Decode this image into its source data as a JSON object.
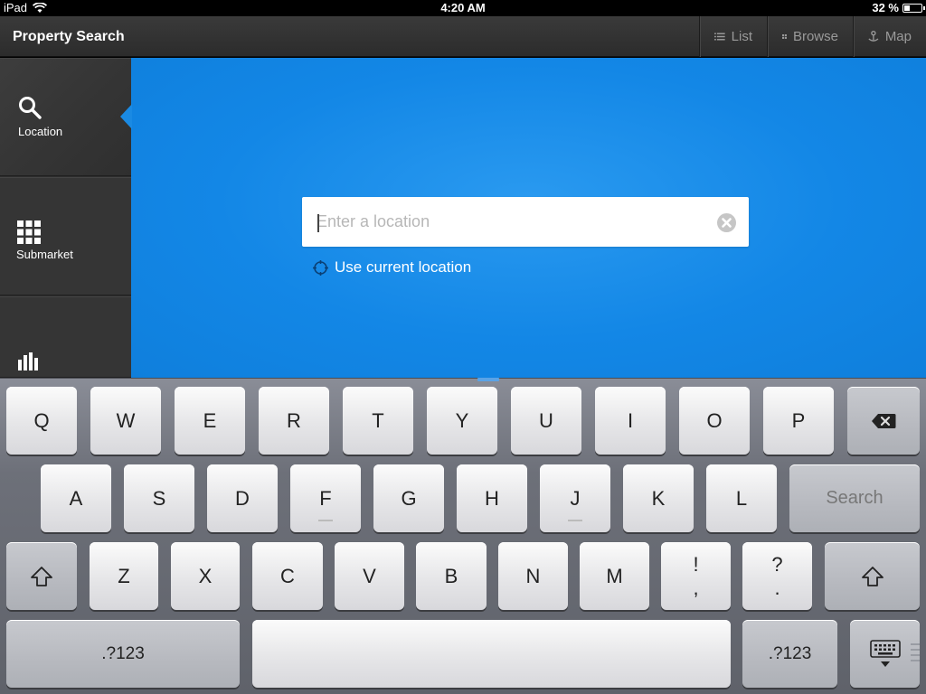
{
  "status": {
    "device": "iPad",
    "time": "4:20 AM",
    "battery": "32 %",
    "battery_level": 0.32
  },
  "nav": {
    "title": "Property Search",
    "actions": [
      {
        "label": "List",
        "icon": "list-icon"
      },
      {
        "label": "Browse",
        "icon": "grid-icon"
      },
      {
        "label": "Map",
        "icon": "map-pin-icon"
      }
    ]
  },
  "sidebar": {
    "items": [
      {
        "label": "Location",
        "icon": "search-icon",
        "selected": true
      },
      {
        "label": "Submarket",
        "icon": "grid-icon",
        "selected": false
      },
      {
        "label": "",
        "icon": "bar-chart-icon",
        "selected": false
      }
    ]
  },
  "main": {
    "search": {
      "placeholder": "Enter a location",
      "value": ""
    },
    "use_current_location": "Use current location"
  },
  "keyboard": {
    "row1": [
      "Q",
      "W",
      "E",
      "R",
      "T",
      "Y",
      "U",
      "I",
      "O",
      "P"
    ],
    "row2": [
      "A",
      "S",
      "D",
      "F",
      "G",
      "H",
      "J",
      "K",
      "L"
    ],
    "row3": [
      "Z",
      "X",
      "C",
      "V",
      "B",
      "N",
      "M"
    ],
    "punct1": {
      "top": "!",
      "bottom": ","
    },
    "punct2": {
      "top": "?",
      "bottom": "."
    },
    "search_key": "Search",
    "num_key": ".?123"
  },
  "colors": {
    "accent": "#1a8ae3",
    "nav": "#333333",
    "sidebar": "#353535"
  }
}
